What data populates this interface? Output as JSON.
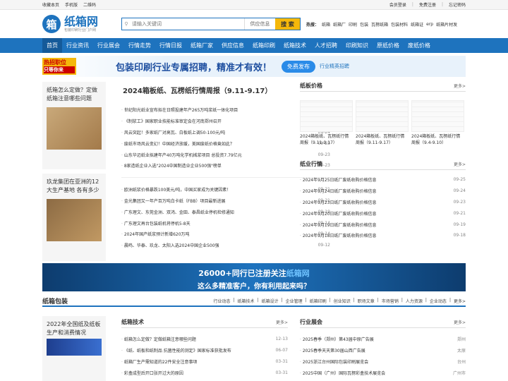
{
  "topbar": {
    "left": [
      "收藏本页",
      "手机版",
      "二维码"
    ],
    "right": [
      "会员登录",
      "免费注册",
      "忘记密码"
    ]
  },
  "logo": {
    "name": "纸箱网",
    "sub": "包装印刷行业门户网"
  },
  "search": {
    "placeholder": "请输入关键词",
    "category": "供应信息",
    "button": "搜 索",
    "hot_label": "热搜：",
    "hot": [
      "纸箱",
      "纸箱厂",
      "印刷",
      "包装",
      "瓦楞纸箱",
      "包装材料",
      "纸箱证",
      "erp",
      "纸箱片材发"
    ]
  },
  "nav": [
    "首页",
    "行业资讯",
    "行业展会",
    "行情走势",
    "行情日报",
    "纸箱厂家",
    "供应信息",
    "纸箱印刷",
    "纸箱技术",
    "人才招聘",
    "印刷知识",
    "原纸价格",
    "废纸价格"
  ],
  "banner": {
    "job1": "热招职位",
    "job2": "只等你来",
    "text": "包装印刷行业专属招聘，精准才有效！",
    "free": "免费发布",
    "slogan": "行业精英招聘"
  },
  "left_cards": [
    {
      "title": "纸箱怎么定做？定做纸箱注意哪些问题"
    },
    {
      "title": "玖龙集团在亚洲的12大生产基地 各有多少"
    }
  ],
  "weekly": {
    "title": "2024箱板纸、瓦楞纸行情周报（9.11-9.17）"
  },
  "news1": [
    {
      "t": "世纪阳光纸业宣布拟在日照投建年产265万吨浆纸一体化项目",
      "d": "09-24"
    },
    {
      "t": "《制浆工》国家职业技能标准审定会在河南郑州召开",
      "d": "09-24"
    },
    {
      "t": "风云突起！多家纸厂对高瓦、白板纸上调50-100元/吨",
      "d": "09-24"
    },
    {
      "t": "废纸市场风云变幻！中国经济放缓，美国废纸价格竟如此？",
      "d": "09-23"
    },
    {
      "t": "山东华迈纸业拟建年产40万吨化学机械浆项目 总投资7.79亿元",
      "d": "09-23"
    },
    {
      "t": "8家造纸企业入选\"2024中国制造业企业500强\"榜单",
      "d": "09-23"
    }
  ],
  "news2": [
    {
      "t": "欧洲纸浆价格暴跌100美元/吨，中国买家成为关键因素！",
      "d": "09-21"
    },
    {
      "t": "金光集团又一年产百万吨白卡纸（FBB）项目最新进展",
      "d": "09-21"
    },
    {
      "t": "广东理文、东莞金洲、双鸿、金田、泰昌纸业停机检修通知",
      "d": "09-19"
    },
    {
      "t": "广东理文再台包装纸机将停机5-8天",
      "d": "09-14"
    },
    {
      "t": "2024年国产纸浆预计新增620万吨",
      "d": "09-14"
    },
    {
      "t": "晨鸣、华泰、玖龙、太阳入选2024中国企业500强",
      "d": "09-12"
    }
  ],
  "price": {
    "title": "纸板价格",
    "more": "更多>",
    "items": [
      "2024箱板纸、瓦楞纸行情周报（9.11-9.17）",
      "2024箱板纸、瓦楞纸行情周报（9.11-9.17）",
      "2024箱板纸、瓦楞纸行情周报（9.4-9.10）"
    ]
  },
  "market": {
    "title": "纸业行情",
    "more": "更多>",
    "items": [
      {
        "t": "2024年9月25日纸厂废纸收购价格信息",
        "d": "09-25"
      },
      {
        "t": "2024年9月24日纸厂废纸收购价格信息",
        "d": "09-24"
      },
      {
        "t": "2024年9月23日纸厂废纸收购价格信息",
        "d": "09-23"
      },
      {
        "t": "2024年9月20日纸厂废纸收购价格信息",
        "d": "09-21"
      },
      {
        "t": "2024年9月19日纸厂废纸收购价格信息",
        "d": "09-19"
      },
      {
        "t": "2024年9月18日纸厂废纸收购价格信息",
        "d": "09-18"
      }
    ]
  },
  "ad": {
    "line1a": "26000+同行已注册关注",
    "line1b": "纸箱网",
    "line2": "这么多精准客户，你有利用起来吗？"
  },
  "section": {
    "title": "纸箱包装",
    "tabs": [
      "行业动态",
      "纸箱技术",
      "纸箱设计",
      "企业管理",
      "纸箱印刷",
      "创业知识",
      "职场文章",
      "市场营销",
      "人力资源",
      "企业动态",
      "更多>"
    ]
  },
  "bottom_card": {
    "title": "2022年全国纸及纸板生产和消费情况"
  },
  "tech": {
    "title": "纸箱技术",
    "more": "更多>",
    "items": [
      {
        "t": "纸箱怎么定做？定做纸箱注意哪些问题",
        "d": "12-13"
      },
      {
        "t": "《纸、纸板和纸制品 抗菌性能的测定》国家标准获批发布",
        "d": "06-07"
      },
      {
        "t": "纸箱厂生产需知道的22件安全注意事项",
        "d": "03-31"
      },
      {
        "t": "彩盒成型后开口张开过大的原因",
        "d": "03-31"
      }
    ]
  },
  "expo": {
    "title": "行业展会",
    "more": "更多>",
    "items": [
      {
        "t": "2025春季（郑州）第43届中原广告展",
        "d": "郑州"
      },
      {
        "t": "2025春季天天第30届山西广告展",
        "d": "太原"
      },
      {
        "t": "2025浙江台州国际包装印刷展览会",
        "d": "台州"
      },
      {
        "t": "2025中国（广州）国际瓦楞彩盒技术展览会",
        "d": "广州市"
      }
    ]
  }
}
